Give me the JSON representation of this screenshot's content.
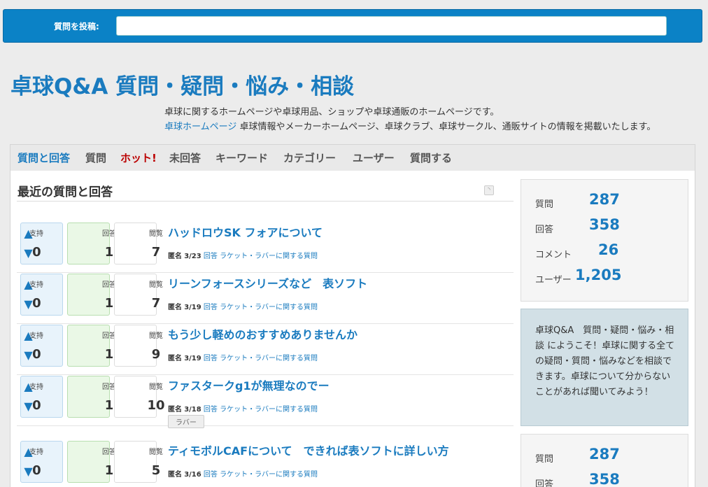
{
  "ask": {
    "label": "質問を投稿:",
    "placeholder": ""
  },
  "site": {
    "title": "卓球Q&A 質問・疑問・悩み・相談",
    "desc_line1": "卓球に関するホームページや卓球用品、ショップや卓球通販のホームページです。",
    "desc_link": "卓球ホームページ",
    "desc_line2_rest": " 卓球情報やメーカーホームページ、卓球クラブ、卓球サークル、通販サイトの情報を掲載いたします。"
  },
  "nav": [
    "質問と回答",
    "質問",
    "ホット!",
    "未回答",
    "キーワード",
    "カテゴリー",
    "ユーザー",
    "質問する"
  ],
  "main": {
    "section_title": "最近の質問と回答"
  },
  "labels": {
    "vote": "支持",
    "answers": "回答",
    "views": "閲覧"
  },
  "questions": [
    {
      "title": "ハッドロウSK フォアについて",
      "votes": "0",
      "answers": "1",
      "views": "7",
      "who": "匿名",
      "date": "3/23",
      "action": "回答",
      "category": "ラケット・ラバーに関する質問",
      "tag": ""
    },
    {
      "title": "リーンフォースシリーズなど　表ソフト",
      "votes": "0",
      "answers": "1",
      "views": "7",
      "who": "匿名",
      "date": "3/19",
      "action": "回答",
      "category": "ラケット・ラバーに関する質問",
      "tag": ""
    },
    {
      "title": "もう少し軽めのおすすめありませんか",
      "votes": "0",
      "answers": "1",
      "views": "9",
      "who": "匿名",
      "date": "3/19",
      "action": "回答",
      "category": "ラケット・ラバーに関する質問",
      "tag": ""
    },
    {
      "title": "ファスタークg1が無理なのでー",
      "votes": "0",
      "answers": "1",
      "views": "10",
      "who": "匿名",
      "date": "3/18",
      "action": "回答",
      "category": "ラケット・ラバーに関する質問",
      "tag": "ラバー"
    },
    {
      "title": "ティモボルCAFについて　できれば表ソフトに詳しい方",
      "votes": "0",
      "answers": "1",
      "views": "5",
      "who": "匿名",
      "date": "3/16",
      "action": "回答",
      "category": "ラケット・ラバーに関する質問",
      "tag": ""
    }
  ],
  "stats": {
    "questions_label": "質問",
    "questions": "287",
    "answers_label": "回答",
    "answers": "358",
    "comments_label": "コメント",
    "comments": "26",
    "users_label": "ユーザー",
    "users": "1,205"
  },
  "welcome": "卓球Q&A　質問・疑問・悩み・相談 にようこそ！卓球に関する全ての疑問・質問・悩みなどを相談できます。卓球について分からないことがあれば聞いてみよう！",
  "colors": {
    "accent": "#1a7bbf",
    "ask_bar": "#0b82c6",
    "hot": "#bb0000",
    "answer_box": "#eaf8e6",
    "vote_box": "#e8f3fb"
  }
}
